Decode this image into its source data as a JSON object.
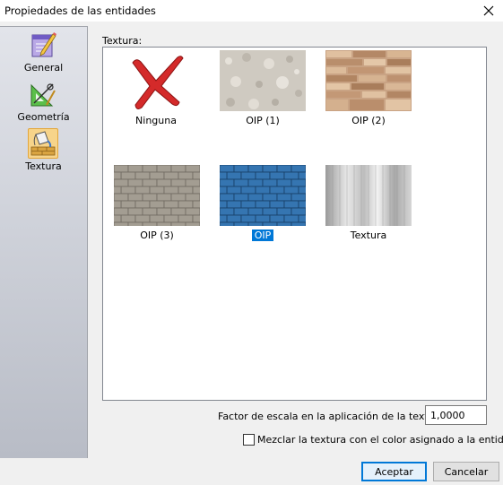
{
  "window": {
    "title": "Propiedades de las entidades",
    "close_icon": "close-icon"
  },
  "sidebar": {
    "items": [
      {
        "label": "General",
        "icon": "notepad-pencil-icon"
      },
      {
        "label": "Geometría",
        "icon": "geometry-tools-icon"
      },
      {
        "label": "Textura",
        "icon": "paint-bucket-icon",
        "selected": true
      }
    ]
  },
  "texture": {
    "group_label": "Textura:",
    "items": [
      {
        "label": "Ninguna",
        "icon": "red-x-icon"
      },
      {
        "label": "OIP (1)",
        "swatch": "stucco-texture"
      },
      {
        "label": "OIP (2)",
        "swatch": "stone-wall-texture"
      },
      {
        "label": "OIP (3)",
        "swatch": "gray-brick-texture"
      },
      {
        "label": "OIP",
        "swatch": "blue-brick-texture",
        "selected": true
      },
      {
        "label": "Textura",
        "swatch": "brushed-metal-texture"
      }
    ]
  },
  "scale": {
    "label": "Factor de escala en la aplicación de la textura:",
    "value": "1,0000"
  },
  "mix": {
    "label": "Mezclar la textura con el color asignado a la entidad.",
    "checked": false
  },
  "buttons": {
    "accept": "Aceptar",
    "cancel": "Cancelar"
  },
  "colors": {
    "selection": "#0078d7",
    "default_button_border": "#0078d7"
  }
}
